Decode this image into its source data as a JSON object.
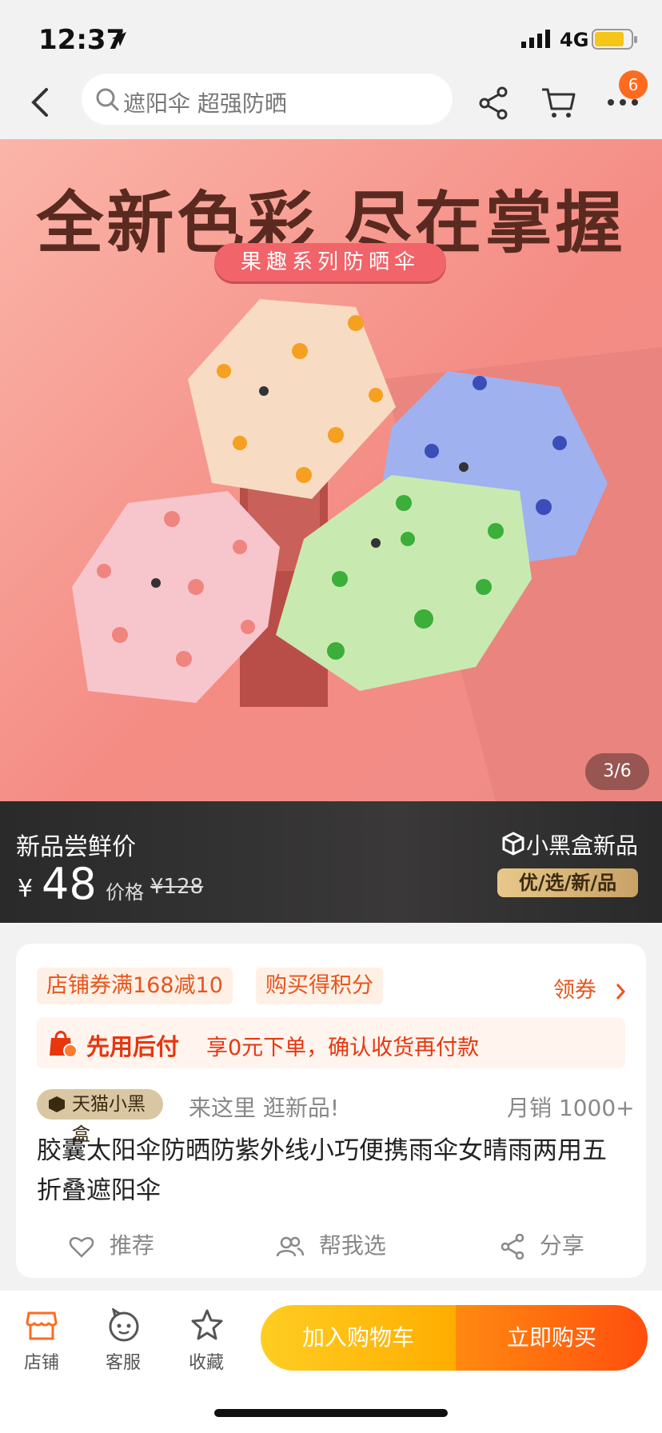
{
  "status": {
    "time": "12:37",
    "network": "4G"
  },
  "nav": {
    "search_placeholder": "遮阳伞 超强防晒",
    "cart_badge": "6"
  },
  "hero": {
    "headline": "全新色彩 尽在掌握",
    "subtitle": "果趣系列防晒伞",
    "counter": "3/6"
  },
  "price_bar": {
    "promo_title": "新品尝鲜价",
    "currency": "¥",
    "price": "48",
    "original_label": "价格",
    "original_price": "¥128",
    "brand": "小黑盒新品",
    "brand_tag": "优/选/新/品"
  },
  "card": {
    "coupon_1": "店铺券满168减10",
    "coupon_2": "购买得积分",
    "get_coupon": "领券",
    "paylater_title": "先用后付",
    "paylater_desc": "享0元下单，确认收货再付款",
    "tmall_tag": "天猫小黑盒",
    "tmall_slogan": "来这里 逛新品!",
    "monthly_sales": "月销 1000+",
    "product_title": "胶囊太阳伞防晒防紫外线小巧便携雨伞女晴雨两用五折叠遮阳伞",
    "action_recommend": "推荐",
    "action_help_choose": "帮我选",
    "action_share": "分享"
  },
  "bottom_bar": {
    "store": "店铺",
    "service": "客服",
    "favorite": "收藏",
    "add_to_cart": "加入购物车",
    "buy_now": "立即购买"
  },
  "colors": {
    "accent": "#ff6a1f",
    "buy_orange": "#ff4e0d",
    "cart_yellow": "#ffc11a",
    "promo_text": "#e8541c"
  },
  "icons": [
    "back-arrow-icon",
    "search-icon",
    "share-icon",
    "cart-icon",
    "more-icon",
    "heart-icon",
    "people-icon",
    "store-icon",
    "service-icon",
    "star-icon",
    "bag-icon",
    "tmall-box-icon"
  ]
}
